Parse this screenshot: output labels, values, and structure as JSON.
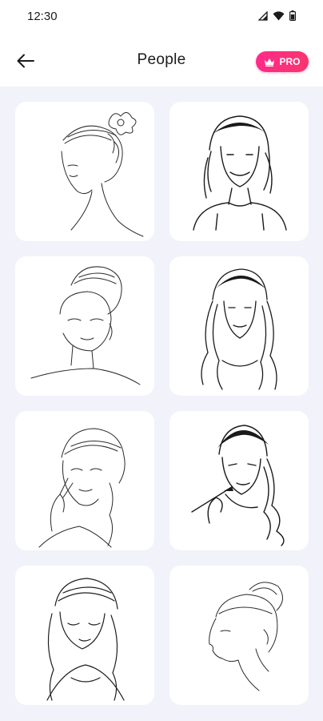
{
  "status_bar": {
    "time": "12:30",
    "icons": [
      "signal-icon",
      "wifi-icon",
      "battery-icon"
    ]
  },
  "header": {
    "back_icon": "arrow-left-icon",
    "title": "People",
    "pro_badge": {
      "icon": "crown-icon",
      "label": "PRO"
    }
  },
  "colors": {
    "background": "#f1f2fa",
    "card": "#ffffff",
    "pro_gradient_start": "#ff2b8a",
    "pro_gradient_end": "#f8356e",
    "ink": "#1b1b1f"
  },
  "gallery": {
    "items": [
      {
        "subject": "woman-updo-flower-sketch"
      },
      {
        "subject": "smiling-woman-tshirt-sketch"
      },
      {
        "subject": "woman-high-bun-sketch"
      },
      {
        "subject": "woman-long-wavy-hair-sketch"
      },
      {
        "subject": "woman-braid-hand-sketch"
      },
      {
        "subject": "woman-makeup-brush-sketch"
      },
      {
        "subject": "woman-eyes-closed-sketch"
      },
      {
        "subject": "woman-profile-bun-sketch"
      }
    ]
  }
}
